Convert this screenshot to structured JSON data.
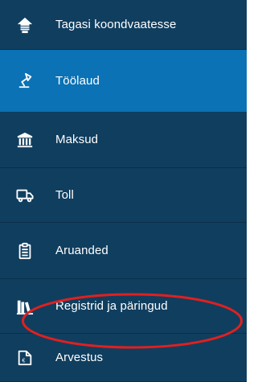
{
  "sidebar": {
    "items": [
      {
        "label": "Tagasi koondvaatesse",
        "icon": "home-arrow-icon",
        "active": false
      },
      {
        "label": "Töölaud",
        "icon": "desk-lamp-icon",
        "active": true
      },
      {
        "label": "Maksud",
        "icon": "bank-icon",
        "active": false
      },
      {
        "label": "Toll",
        "icon": "truck-icon",
        "active": false
      },
      {
        "label": "Aruanded",
        "icon": "clipboard-icon",
        "active": false
      },
      {
        "label": "Registrid ja päringud",
        "icon": "books-icon",
        "active": false
      },
      {
        "label": "Arvestus",
        "icon": "calculator-icon",
        "active": false
      }
    ]
  },
  "colors": {
    "sidebar_bg": "#103e5f",
    "active_bg": "#0a72b5",
    "annotation": "#e0201f"
  },
  "annotation": {
    "shape": "ellipse",
    "highlighted_item": "Registrid ja päringud"
  }
}
